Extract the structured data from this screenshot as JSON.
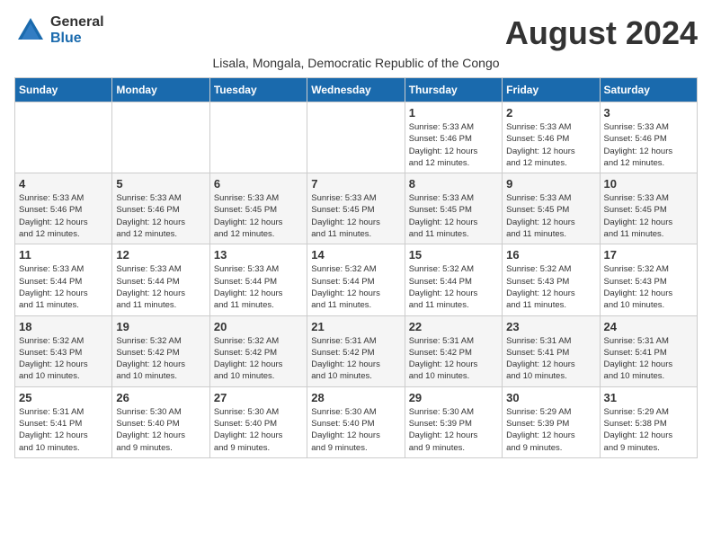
{
  "header": {
    "logo_general": "General",
    "logo_blue": "Blue",
    "month_year": "August 2024",
    "subtitle": "Lisala, Mongala, Democratic Republic of the Congo"
  },
  "weekdays": [
    "Sunday",
    "Monday",
    "Tuesday",
    "Wednesday",
    "Thursday",
    "Friday",
    "Saturday"
  ],
  "weeks": [
    [
      {
        "day": "",
        "info": ""
      },
      {
        "day": "",
        "info": ""
      },
      {
        "day": "",
        "info": ""
      },
      {
        "day": "",
        "info": ""
      },
      {
        "day": "1",
        "info": "Sunrise: 5:33 AM\nSunset: 5:46 PM\nDaylight: 12 hours\nand 12 minutes."
      },
      {
        "day": "2",
        "info": "Sunrise: 5:33 AM\nSunset: 5:46 PM\nDaylight: 12 hours\nand 12 minutes."
      },
      {
        "day": "3",
        "info": "Sunrise: 5:33 AM\nSunset: 5:46 PM\nDaylight: 12 hours\nand 12 minutes."
      }
    ],
    [
      {
        "day": "4",
        "info": "Sunrise: 5:33 AM\nSunset: 5:46 PM\nDaylight: 12 hours\nand 12 minutes."
      },
      {
        "day": "5",
        "info": "Sunrise: 5:33 AM\nSunset: 5:46 PM\nDaylight: 12 hours\nand 12 minutes."
      },
      {
        "day": "6",
        "info": "Sunrise: 5:33 AM\nSunset: 5:45 PM\nDaylight: 12 hours\nand 12 minutes."
      },
      {
        "day": "7",
        "info": "Sunrise: 5:33 AM\nSunset: 5:45 PM\nDaylight: 12 hours\nand 11 minutes."
      },
      {
        "day": "8",
        "info": "Sunrise: 5:33 AM\nSunset: 5:45 PM\nDaylight: 12 hours\nand 11 minutes."
      },
      {
        "day": "9",
        "info": "Sunrise: 5:33 AM\nSunset: 5:45 PM\nDaylight: 12 hours\nand 11 minutes."
      },
      {
        "day": "10",
        "info": "Sunrise: 5:33 AM\nSunset: 5:45 PM\nDaylight: 12 hours\nand 11 minutes."
      }
    ],
    [
      {
        "day": "11",
        "info": "Sunrise: 5:33 AM\nSunset: 5:44 PM\nDaylight: 12 hours\nand 11 minutes."
      },
      {
        "day": "12",
        "info": "Sunrise: 5:33 AM\nSunset: 5:44 PM\nDaylight: 12 hours\nand 11 minutes."
      },
      {
        "day": "13",
        "info": "Sunrise: 5:33 AM\nSunset: 5:44 PM\nDaylight: 12 hours\nand 11 minutes."
      },
      {
        "day": "14",
        "info": "Sunrise: 5:32 AM\nSunset: 5:44 PM\nDaylight: 12 hours\nand 11 minutes."
      },
      {
        "day": "15",
        "info": "Sunrise: 5:32 AM\nSunset: 5:44 PM\nDaylight: 12 hours\nand 11 minutes."
      },
      {
        "day": "16",
        "info": "Sunrise: 5:32 AM\nSunset: 5:43 PM\nDaylight: 12 hours\nand 11 minutes."
      },
      {
        "day": "17",
        "info": "Sunrise: 5:32 AM\nSunset: 5:43 PM\nDaylight: 12 hours\nand 10 minutes."
      }
    ],
    [
      {
        "day": "18",
        "info": "Sunrise: 5:32 AM\nSunset: 5:43 PM\nDaylight: 12 hours\nand 10 minutes."
      },
      {
        "day": "19",
        "info": "Sunrise: 5:32 AM\nSunset: 5:42 PM\nDaylight: 12 hours\nand 10 minutes."
      },
      {
        "day": "20",
        "info": "Sunrise: 5:32 AM\nSunset: 5:42 PM\nDaylight: 12 hours\nand 10 minutes."
      },
      {
        "day": "21",
        "info": "Sunrise: 5:31 AM\nSunset: 5:42 PM\nDaylight: 12 hours\nand 10 minutes."
      },
      {
        "day": "22",
        "info": "Sunrise: 5:31 AM\nSunset: 5:42 PM\nDaylight: 12 hours\nand 10 minutes."
      },
      {
        "day": "23",
        "info": "Sunrise: 5:31 AM\nSunset: 5:41 PM\nDaylight: 12 hours\nand 10 minutes."
      },
      {
        "day": "24",
        "info": "Sunrise: 5:31 AM\nSunset: 5:41 PM\nDaylight: 12 hours\nand 10 minutes."
      }
    ],
    [
      {
        "day": "25",
        "info": "Sunrise: 5:31 AM\nSunset: 5:41 PM\nDaylight: 12 hours\nand 10 minutes."
      },
      {
        "day": "26",
        "info": "Sunrise: 5:30 AM\nSunset: 5:40 PM\nDaylight: 12 hours\nand 9 minutes."
      },
      {
        "day": "27",
        "info": "Sunrise: 5:30 AM\nSunset: 5:40 PM\nDaylight: 12 hours\nand 9 minutes."
      },
      {
        "day": "28",
        "info": "Sunrise: 5:30 AM\nSunset: 5:40 PM\nDaylight: 12 hours\nand 9 minutes."
      },
      {
        "day": "29",
        "info": "Sunrise: 5:30 AM\nSunset: 5:39 PM\nDaylight: 12 hours\nand 9 minutes."
      },
      {
        "day": "30",
        "info": "Sunrise: 5:29 AM\nSunset: 5:39 PM\nDaylight: 12 hours\nand 9 minutes."
      },
      {
        "day": "31",
        "info": "Sunrise: 5:29 AM\nSunset: 5:38 PM\nDaylight: 12 hours\nand 9 minutes."
      }
    ]
  ]
}
